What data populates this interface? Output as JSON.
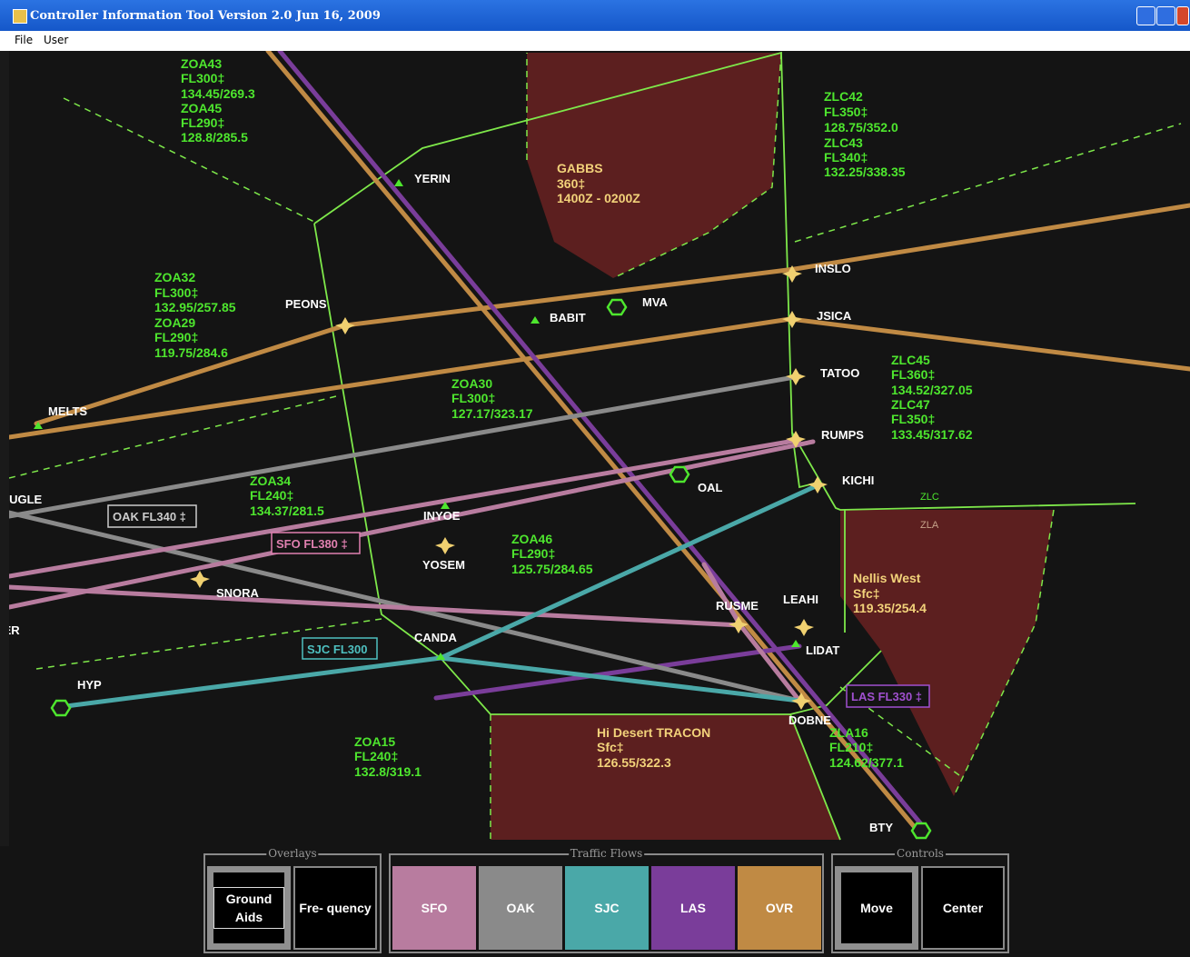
{
  "window": {
    "title": "Controller Information Tool  Version 2.0  Jun 16, 2009"
  },
  "menu": [
    "File",
    "User"
  ],
  "fixes": {
    "yerin": "YERIN",
    "peons": "PEONS",
    "babit": "BABIT",
    "mva": "MVA",
    "inslo": "INSLO",
    "jsica": "JSICA",
    "tatoo": "TATOO",
    "rumps": "RUMPS",
    "kichi": "KICHI",
    "oal": "OAL",
    "melts": "MELTS",
    "ougle": "OUGLE",
    "inyoe": "INYOE",
    "yosem": "YOSEM",
    "snora": "SNORA",
    "ier": "IER",
    "canda": "CANDA",
    "hyp": "HYP",
    "rusme": "RUSME",
    "leahi": "LEAHI",
    "lidat": "LIDAT",
    "dobne": "DOBNE",
    "bty": "BTY"
  },
  "sectors": {
    "zoa43": [
      "ZOA43",
      "FL300‡",
      "134.45/269.3",
      "ZOA45",
      "FL290‡",
      "128.8/285.5"
    ],
    "zlc42": [
      "ZLC42",
      "FL350‡",
      "128.75/352.0",
      "ZLC43",
      "FL340‡",
      "132.25/338.35"
    ],
    "zoa32": [
      "ZOA32",
      "FL300‡",
      "132.95/257.85",
      "ZOA29",
      "FL290‡",
      "119.75/284.6"
    ],
    "zoa30": [
      "ZOA30",
      "FL300‡",
      "127.17/323.17"
    ],
    "zlc45": [
      "ZLC45",
      "FL360‡",
      "134.52/327.05",
      "ZLC47",
      "FL350‡",
      "133.45/317.62"
    ],
    "zoa34": [
      "ZOA34",
      "FL240‡",
      "134.37/281.5"
    ],
    "zoa46": [
      "ZOA46",
      "FL290‡",
      "125.75/284.65"
    ],
    "zoa15": [
      "ZOA15",
      "FL240‡",
      "132.8/319.1"
    ],
    "zla16": [
      "ZLA16",
      "FL210‡",
      "124.62/377.1"
    ]
  },
  "zones": {
    "gabbs": [
      "GABBS",
      "360‡",
      "1400Z - 0200Z"
    ],
    "nellis": [
      "Nellis West",
      "Sfc‡",
      "119.35/254.4"
    ],
    "desert": [
      "Hi Desert TRACON",
      "Sfc‡",
      "126.55/322.3"
    ]
  },
  "boundary_labels": {
    "zlc": "ZLC",
    "zla": "ZLA"
  },
  "flow_tags": {
    "oak": "OAK FL340 ‡",
    "sfo": "SFO FL380 ‡",
    "sjc": "SJC FL300",
    "las": "LAS FL330 ‡"
  },
  "colors": {
    "sfo": "#b87c9f",
    "oak": "#8a8a8a",
    "sjc": "#4aa8a8",
    "las": "#7a3d9a",
    "ovr": "#c08a44",
    "sector_line": "#7ee84a",
    "restricted": "#5c1f1f",
    "text_green": "#4ee62e"
  },
  "overlays": {
    "title": "Overlays",
    "ground_aids": "Ground Aids",
    "frequency": "Fre- quency"
  },
  "traffic_flows": {
    "title": "Traffic Flows",
    "buttons": [
      {
        "label": "SFO",
        "color": "#b87c9f"
      },
      {
        "label": "OAK",
        "color": "#8a8a8a"
      },
      {
        "label": "SJC",
        "color": "#4aa8a8"
      },
      {
        "label": "LAS",
        "color": "#7a3d9a"
      },
      {
        "label": "OVR",
        "color": "#c08a44"
      }
    ]
  },
  "controls": {
    "title": "Controls",
    "move": "Move",
    "center": "Center"
  }
}
